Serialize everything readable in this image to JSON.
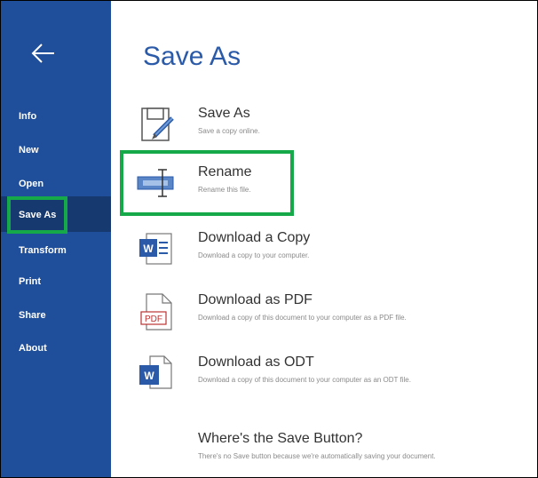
{
  "nav": {
    "back_icon": "arrow-left-icon",
    "items": [
      {
        "label": "Info"
      },
      {
        "label": "New"
      },
      {
        "label": "Open"
      },
      {
        "label": "Save As"
      },
      {
        "label": "Transform"
      },
      {
        "label": "Print"
      },
      {
        "label": "Share"
      },
      {
        "label": "About"
      }
    ]
  },
  "main": {
    "title": "Save As",
    "options": [
      {
        "title": "Save As",
        "desc": "Save a copy online.",
        "icon": "save-as-icon"
      },
      {
        "title": "Rename",
        "desc": "Rename this file.",
        "icon": "rename-icon"
      },
      {
        "title": "Download a Copy",
        "desc": "Download a copy to your computer.",
        "icon": "word-doc-icon"
      },
      {
        "title": "Download as PDF",
        "desc": "Download a copy of this document to your computer as a PDF file.",
        "icon": "pdf-doc-icon"
      },
      {
        "title": "Download as ODT",
        "desc": "Download a copy of this document to your computer as an ODT file.",
        "icon": "odt-doc-icon"
      },
      {
        "title": "Where's the Save Button?",
        "desc": "There's no Save button because we're automatically saving your document."
      }
    ]
  },
  "colors": {
    "sidebar": "#1f4f9a",
    "active": "#16396f",
    "highlight": "#16a94a",
    "title": "#2b5aa8"
  }
}
